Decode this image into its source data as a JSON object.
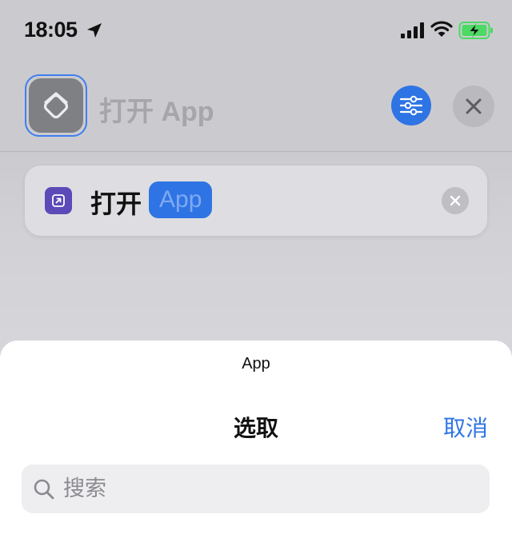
{
  "status_bar": {
    "time": "18:05",
    "icons": [
      "location-arrow-icon",
      "cellular-signal-icon",
      "wifi-icon",
      "battery-charging-icon"
    ]
  },
  "header": {
    "title": "打开 App",
    "app_icon": "shortcuts-layers-icon",
    "settings_icon": "sliders-icon",
    "close_icon": "close-icon"
  },
  "action": {
    "verb": "打开",
    "parameter": "App",
    "icon": "open-app-arrow-icon",
    "remove_icon": "remove-icon"
  },
  "sheet": {
    "caption": "App",
    "title": "选取",
    "cancel_label": "取消",
    "search": {
      "placeholder": "搜索",
      "value": ""
    }
  },
  "colors": {
    "accent": "#2f74e4",
    "action_icon_bg": "#5b4ab8",
    "battery_green": "#4cd964",
    "dimmed_background": "#cbcbcf"
  }
}
